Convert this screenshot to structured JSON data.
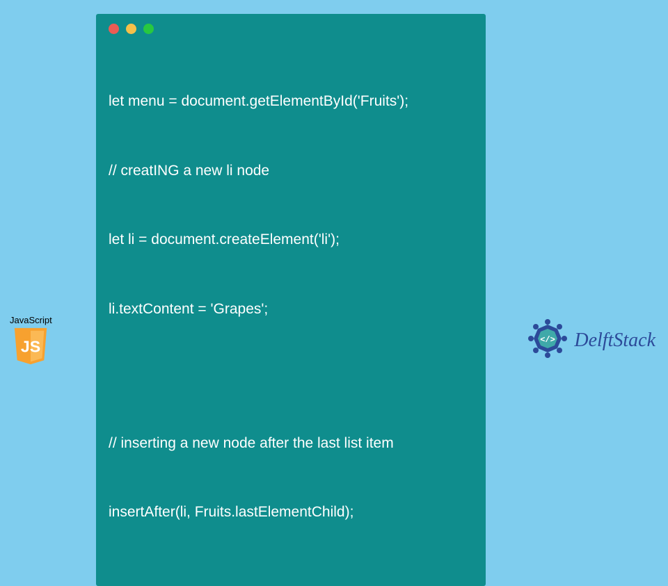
{
  "code": {
    "line1": "let menu = document.getElementById('Fruits');",
    "line2": "// creatING a new li node",
    "line3": "let li = document.createElement('li');",
    "line4": "li.textContent = 'Grapes';",
    "line5": "// inserting a new node after the last list item",
    "line6": "insertAfter(li, Fruits.lastElementChild);"
  },
  "badges": {
    "js_label": "JavaScript",
    "js_letters": "JS",
    "brand": "DelftStack"
  },
  "colors": {
    "bg": "#7fcdee",
    "window": "#0f8d8d",
    "js_shield": "#f7a12f",
    "brand_blue": "#2c4a99"
  }
}
